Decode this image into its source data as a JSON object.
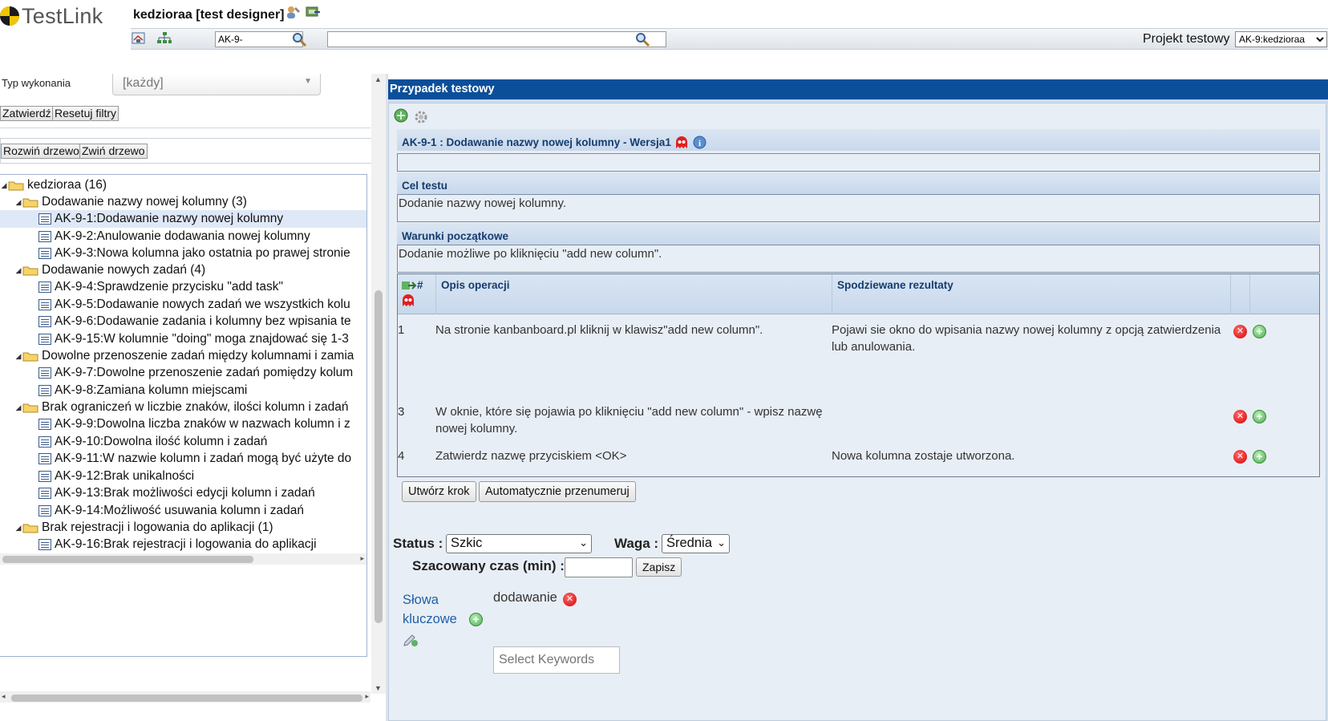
{
  "header": {
    "logo_text": "TestLink",
    "user_title": "kedzioraa [test designer]",
    "tc_id_input_value": "AK-9-",
    "search_input_value": "",
    "project_label": "Projekt testowy",
    "project_selected": "AK-9:kedzioraa"
  },
  "filters": {
    "execution_type_label": "Typ wykonania",
    "execution_type_value": "[każdy]",
    "apply_button": "Zatwierdź",
    "reset_button": "Resetuj filtry"
  },
  "tree_actions": {
    "expand_button": "Rozwiń drzewo",
    "collapse_button": "Zwiń drzewo"
  },
  "tree": {
    "root": "kedzioraa (16)",
    "suites": [
      {
        "label": "Dodawanie nazwy nowej kolumny (3)",
        "cases": [
          "AK-9-1:Dodawanie nazwy nowej kolumny",
          "AK-9-2:Anulowanie dodawania nowej kolumny",
          "AK-9-3:Nowa kolumna jako ostatnia po prawej stronie"
        ]
      },
      {
        "label": "Dodawanie nowych zadań (4)",
        "cases": [
          "AK-9-4:Sprawdzenie przycisku \"add task\"",
          "AK-9-5:Dodawanie nowych zadań we wszystkich kolu",
          "AK-9-6:Dodawanie zadania i kolumny bez wpisania te",
          "AK-9-15:W kolumnie \"doing\" moga znajdować się 1-3"
        ]
      },
      {
        "label": "Dowolne przenoszenie zadań między kolumnami i zamia",
        "cases": [
          "AK-9-7:Dowolne przenoszenie zadań pomiędzy kolum",
          "AK-9-8:Zamiana kolumn miejscami"
        ]
      },
      {
        "label": "Brak ograniczeń w liczbie znaków, ilości kolumn i zadań",
        "cases": [
          "AK-9-9:Dowolna liczba znaków w nazwach kolumn i z",
          "AK-9-10:Dowolna ilość kolumn i zadań",
          "AK-9-11:W nazwie kolumn i zadań mogą być użyte do",
          "AK-9-12:Brak unikalności",
          "AK-9-13:Brak możliwości edycji kolumn i zadań",
          "AK-9-14:Możliwość usuwania kolumn i zadań"
        ]
      },
      {
        "label": "Brak rejestracji i logowania do aplikacji (1)",
        "cases": [
          "AK-9-16:Brak rejestracji i logowania do aplikacji"
        ]
      }
    ]
  },
  "testcase": {
    "panel_title": "Przypadek testowy",
    "title": "AK-9-1 : Dodawanie nazwy nowej kolumny - Wersja1",
    "summary_heading": "Cel testu",
    "summary_text": "Dodanie nazwy nowej kolumny.",
    "preconditions_heading": "Warunki początkowe",
    "preconditions_text": "Dodanie możliwe po kliknięciu \"add new column\".",
    "steps_header": {
      "number": "#",
      "actions": "Opis operacji",
      "expected": "Spodziewane rezultaty"
    },
    "steps": [
      {
        "num": "1",
        "action": "Na stronie kanbanboard.pl kliknij w klawisz\"add new column\".",
        "expected": "Pojawi sie okno do wpisania nazwy nowej kolumny z opcją zatwierdzenia lub anulowania."
      },
      {
        "num": "3",
        "action": "W oknie, które się pojawia po kliknięciu \"add new column\" - wpisz nazwę nowej kolumny.",
        "expected": ""
      },
      {
        "num": "4",
        "action": "Zatwierdz nazwę przyciskiem <OK>",
        "expected": "Nowa kolumna zostaje utworzona."
      }
    ],
    "create_step_button": "Utwórz krok",
    "renumber_button": "Automatycznie przenumeruj",
    "status_label": "Status :",
    "status_value": "Szkic",
    "importance_label": "Waga :",
    "importance_value": "Średnia",
    "estimated_label": "Szacowany czas (min) :",
    "estimated_value": "",
    "save_button": "Zapisz",
    "keywords_label": "Słowa kluczowe",
    "keyword_tag": "dodawanie",
    "keywords_placeholder": "Select Keywords"
  },
  "colors": {
    "panel_header_bg": "#0b4f9a",
    "panel_bg": "#cfdced",
    "heading_text": "#153c6e",
    "link": "#1f5fa8",
    "delete_red": "#d40000",
    "add_green": "#4fae4f"
  }
}
